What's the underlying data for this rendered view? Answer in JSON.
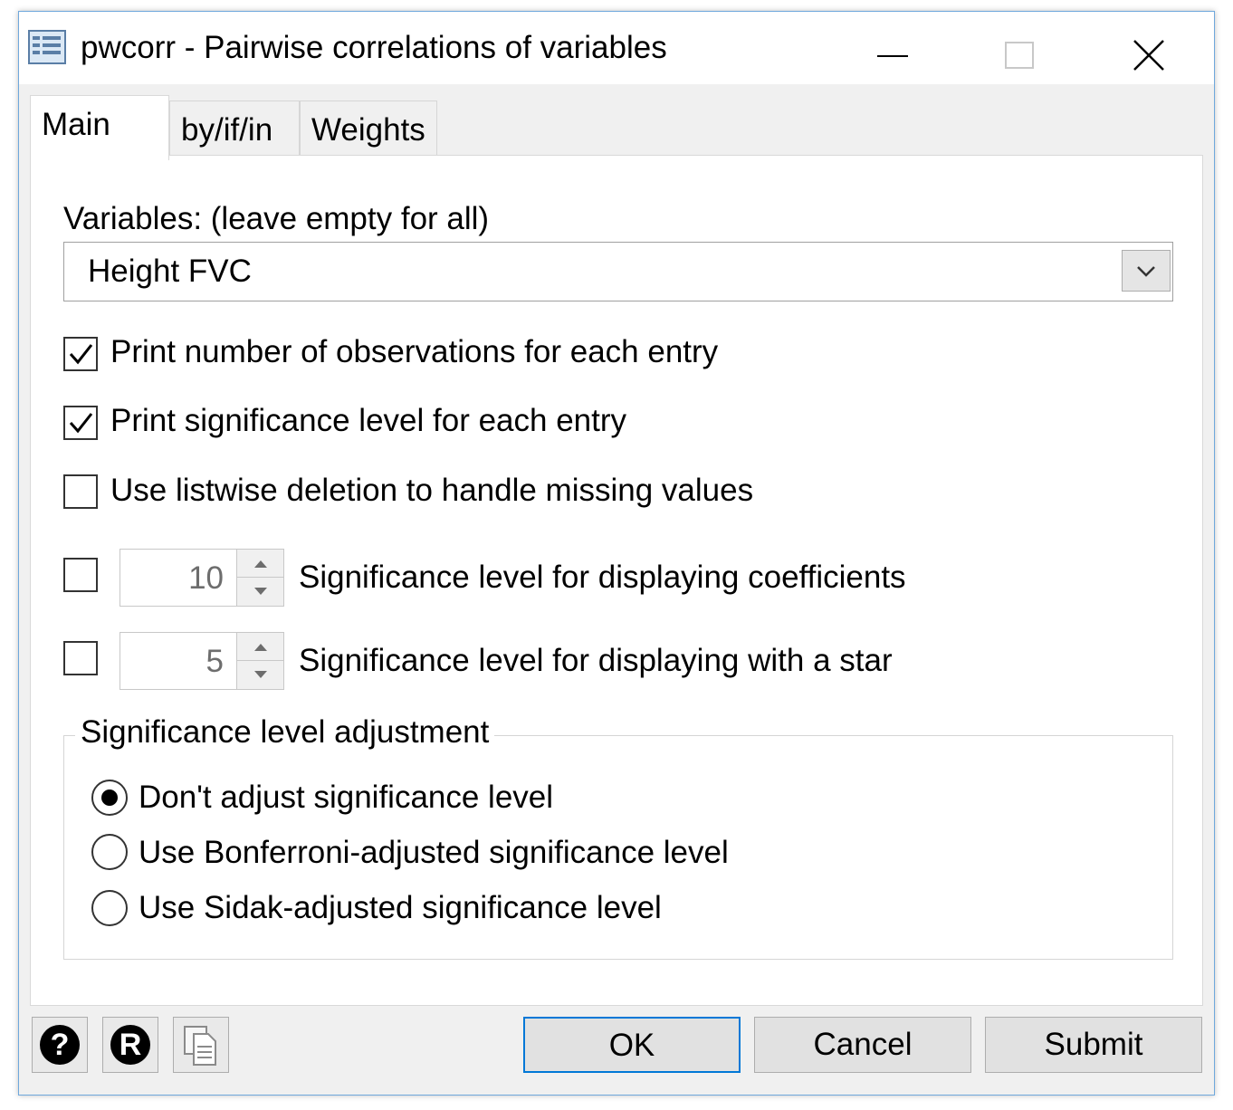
{
  "window": {
    "title": "pwcorr - Pairwise correlations of variables"
  },
  "tabs": [
    {
      "label": "Main",
      "active": true
    },
    {
      "label": "by/if/in",
      "active": false
    },
    {
      "label": "Weights",
      "active": false
    }
  ],
  "main": {
    "variables_label": "Variables: (leave empty for all)",
    "variables_value": "Height FVC",
    "options": [
      {
        "label": "Print number of observations for each entry",
        "checked": true
      },
      {
        "label": "Print significance level for each entry",
        "checked": true
      },
      {
        "label": "Use listwise deletion to handle missing values",
        "checked": false
      }
    ],
    "spinners": [
      {
        "value": "10",
        "label": "Significance level for displaying coefficients",
        "checked": false
      },
      {
        "value": "5",
        "label": "Significance level for displaying with a star",
        "checked": false
      }
    ],
    "adjustment": {
      "title": "Significance level adjustment",
      "choices": [
        {
          "label": "Don't adjust significance level",
          "selected": true
        },
        {
          "label": "Use Bonferroni-adjusted significance level",
          "selected": false
        },
        {
          "label": "Use Sidak-adjusted significance level",
          "selected": false
        }
      ]
    }
  },
  "footer": {
    "help_glyph": "?",
    "reset_glyph": "R",
    "ok_label": "OK",
    "cancel_label": "Cancel",
    "submit_label": "Submit"
  }
}
